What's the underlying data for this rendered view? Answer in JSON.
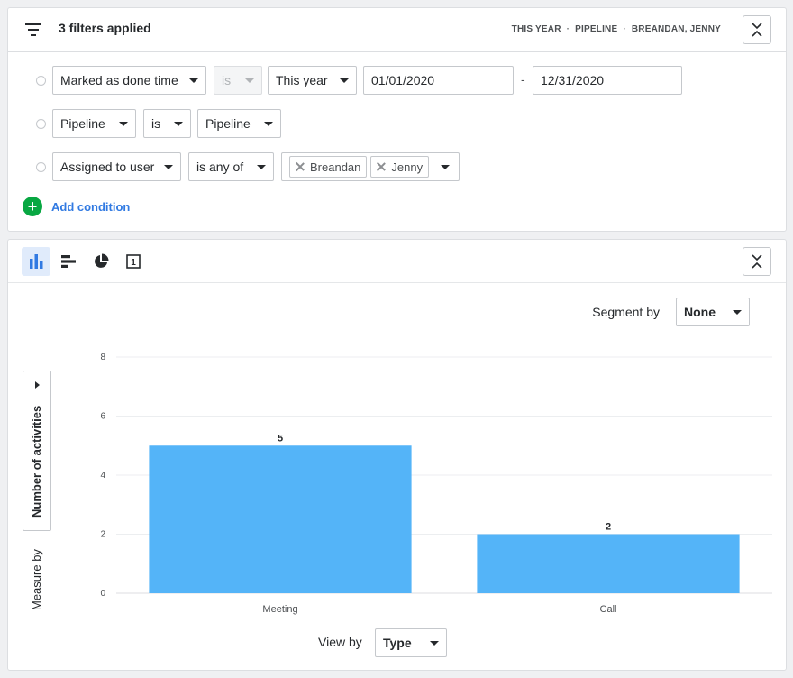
{
  "filters": {
    "title": "3 filters applied",
    "summary": [
      "THIS YEAR",
      "PIPELINE",
      "BREANDAN, JENNY"
    ],
    "separator": "·",
    "conditions": [
      {
        "field": "Marked as done time",
        "operator": "is",
        "value": "This year",
        "date_from": "01/01/2020",
        "date_to": "12/31/2020",
        "range_sep": "-"
      },
      {
        "field": "Pipeline",
        "operator": "is",
        "value": "Pipeline"
      },
      {
        "field": "Assigned to user",
        "operator": "is any of",
        "chips": [
          "Breandan",
          "Jenny"
        ]
      }
    ],
    "add_condition": "Add condition",
    "add_icon": "+"
  },
  "toolbar": {
    "tools": [
      "bar-chart-icon",
      "horizontal-bar-icon",
      "pie-chart-icon",
      "scorecard-icon"
    ],
    "active": "bar-chart-icon",
    "scorecard_glyph": "1"
  },
  "segment": {
    "label": "Segment by",
    "value": "None"
  },
  "measure": {
    "label": "Measure by",
    "value": "Number of activities"
  },
  "view": {
    "label": "View by",
    "value": "Type"
  },
  "colors": {
    "bar": "#54b4f8",
    "accent": "#317ae2",
    "add": "#08a742"
  },
  "chart_data": {
    "type": "bar",
    "categories": [
      "Meeting",
      "Call"
    ],
    "values": [
      5,
      2
    ],
    "ylim": [
      0,
      8
    ],
    "yticks": [
      0,
      2,
      4,
      6,
      8
    ],
    "grid": true,
    "data_labels": true
  }
}
